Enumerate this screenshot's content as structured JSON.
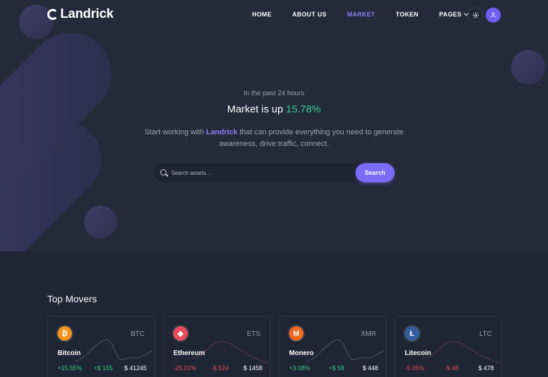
{
  "nav": {
    "brand": "Landrick",
    "links": [
      {
        "label": "HOME"
      },
      {
        "label": "ABOUT US"
      },
      {
        "label": "MARKET"
      },
      {
        "label": "TOKEN"
      },
      {
        "label": "PAGES"
      }
    ],
    "gear_icon": "gear-icon",
    "user_icon": "user-icon"
  },
  "hero": {
    "subtitle": "In the past 24 hours",
    "headline_prefix": "Market is up",
    "headline_value": "15.78%",
    "lead_before": "Start working with",
    "lead_brand": "Landrick",
    "lead_after": "that can provide everything you need to generate awareness, drive traffic, connect."
  },
  "search": {
    "placeholder": "Search assets...",
    "button_label": "Search"
  },
  "movers": {
    "title": "Top Movers",
    "cards": [
      {
        "name": "Bitcoin",
        "symbol": "BTC",
        "change": "+15.55%",
        "delta": "+$ 155",
        "price": "$ 41245",
        "trend": "up",
        "icon_color": "#f7931a",
        "icon_glyph": "₿"
      },
      {
        "name": "Ethereum",
        "symbol": "ETS",
        "change": "-25.01%",
        "delta": "-$ 524",
        "price": "$ 1458",
        "trend": "down",
        "icon_color": "#e84c5c",
        "icon_glyph": "◆"
      },
      {
        "name": "Monero",
        "symbol": "XMR",
        "change": "+3.08%",
        "delta": "+$ 58",
        "price": "$ 448",
        "trend": "up",
        "icon_color": "#f26822",
        "icon_glyph": "M"
      },
      {
        "name": "Litecoin",
        "symbol": "LTC",
        "change": "-5.05%",
        "delta": "-$ 48",
        "price": "$ 478",
        "trend": "down",
        "icon_color": "#345d9d",
        "icon_glyph": "Ł"
      }
    ]
  }
}
